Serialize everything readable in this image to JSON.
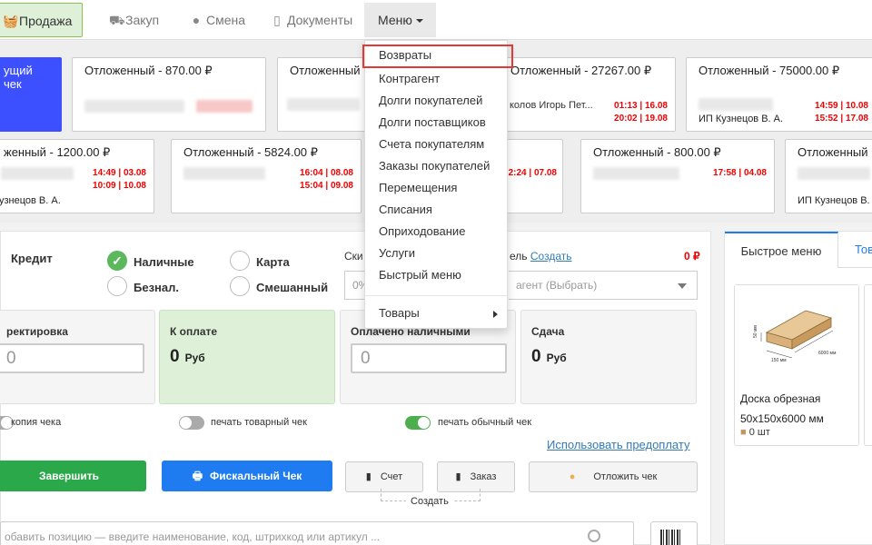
{
  "nav": {
    "sale": "Продажа",
    "zakup": "Закуп",
    "smena": "Смена",
    "documents": "Документы",
    "menu": "Меню"
  },
  "current_check_label": "ущий чек",
  "cards": [
    {
      "title": "Отложенный - 870.00 ₽"
    },
    {
      "title": "Отложенный - 75000.00 ₽",
      "times": [
        "14:59 | 10.08",
        "15:52 | 17.08"
      ],
      "owner": "ИП Кузнецов В. А."
    },
    {
      "title": "женный - 1200.00 ₽",
      "times": [
        "14:49 | 03.08",
        "10:09 | 10.08"
      ],
      "owner": "узнецов В. А."
    },
    {
      "title": "Отложенный - 5824.00 ₽",
      "times": [
        "16:04 | 08.08",
        "15:04 | 09.08"
      ]
    },
    {
      "title": "Отложенный - 800.00 ₽",
      "times": [
        "17:58 | 04.08"
      ]
    },
    {
      "title": "Отложенный",
      "owner": "ИП Кузнецов В. А."
    },
    {
      "title": "Отложенный"
    },
    {
      "title": "Отложенный - 27267.00 ₽",
      "name": "колов Игорь Пет...",
      "times": [
        "01:13 | 16.08",
        "20:02 | 19.08"
      ]
    },
    {
      "time": "2:24 | 07.08"
    }
  ],
  "payment": {
    "credit": "Кредит",
    "cash": "Наличные",
    "card": "Карта",
    "noncash": "Безнал.",
    "mixed": "Смешанный"
  },
  "discount": {
    "label": "Ски",
    "placeholder": "0%"
  },
  "counterparty": {
    "label": "ель",
    "create_link": "Создать",
    "amount": "0 ₽",
    "placeholder": "агент (Выбрать)"
  },
  "sums": {
    "correction": {
      "label": "ректировка",
      "value": "0"
    },
    "to_pay": {
      "label": "К оплате",
      "value": "0",
      "currency": "Руб"
    },
    "paid_cash": {
      "label": "Оплачено наличными",
      "value": "0"
    },
    "change": {
      "label": "Сдача",
      "value": "0",
      "currency": "Руб"
    }
  },
  "toggles": {
    "copy": "копия чека",
    "print_goods": "печать товарный чек",
    "print_normal": "печать обычный чек"
  },
  "prepay_link": "Использовать предоплату",
  "buttons": {
    "finish": "Завершить",
    "fiscal": "Фискальный Чек",
    "invoice": "Счет",
    "order": "Заказ",
    "defer": "Отложить чек",
    "create": "Создать"
  },
  "search_placeholder": "обавить позицию — введите наименование, код, штрихкод или артикул ...",
  "right_panel": {
    "tab_quick": "Быстрое меню",
    "tab_other": "Тов",
    "product": {
      "name": "Доска обрезная",
      "size": "50x150x6000 мм",
      "stock": "0 шт"
    },
    "dims": {
      "h": "50 мм",
      "w": "150 мм",
      "l": "6000 мм"
    }
  },
  "menu_items": [
    "Возвраты",
    "Контрагент",
    "Долги покупателей",
    "Долги поставщиков",
    "Счета покупателям",
    "Заказы покупателей",
    "Перемещения",
    "Списания",
    "Оприходование",
    "Услуги",
    "Быстрый меню"
  ],
  "menu_goods": "Товары",
  "colors": {
    "accent": "#1e7cf0",
    "success": "#2aa84a",
    "danger": "#e53935",
    "current": "#3c50ff"
  }
}
